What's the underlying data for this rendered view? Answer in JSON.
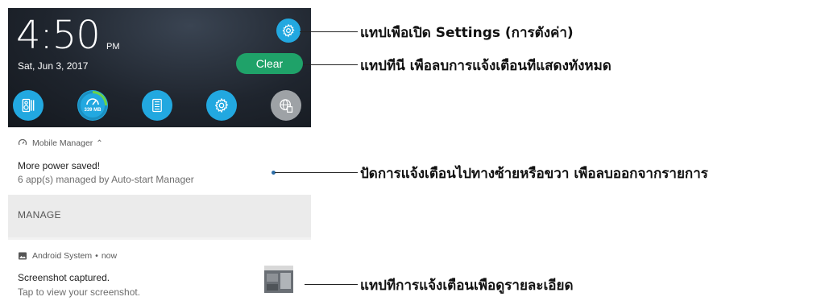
{
  "status": {
    "time": "4:50",
    "ampm": "PM",
    "date": "Sat, Jun 3, 2017"
  },
  "header": {
    "clear_label": "Clear"
  },
  "quick_settings": [
    {
      "icon": "sound-settings-icon"
    },
    {
      "icon": "memory-boost-icon",
      "memory_label": "339 MB"
    },
    {
      "icon": "calculator-icon"
    },
    {
      "icon": "settings-gear-icon"
    },
    {
      "icon": "globe-network-icon"
    }
  ],
  "notifications": [
    {
      "app": "Mobile Manager",
      "title": "More power saved!",
      "text": "6 app(s) managed by Auto-start Manager",
      "action": "MANAGE"
    },
    {
      "app": "Android System",
      "when": "now",
      "title": "Screenshot captured.",
      "text": "Tap to view your screenshot."
    }
  ],
  "callouts": {
    "settings": {
      "prefix": "แทปเพือเปิด ",
      "bold": "Settings (การตังค่า)"
    },
    "clear": "แทปทีนี เพือลบการแจ้งเตือนทีแสดงทังหมด",
    "swipe": "ปัดการแจ้งเตือนไปทางซ้ายหรือขวา เพือลบออกจากรายการ",
    "tap": "แทปทีการแจ้งเตือนเพือดูรายละเอียด"
  },
  "colors": {
    "accent": "#22a8e0",
    "clear": "#1fa269",
    "header_bg": "#1f252e"
  }
}
